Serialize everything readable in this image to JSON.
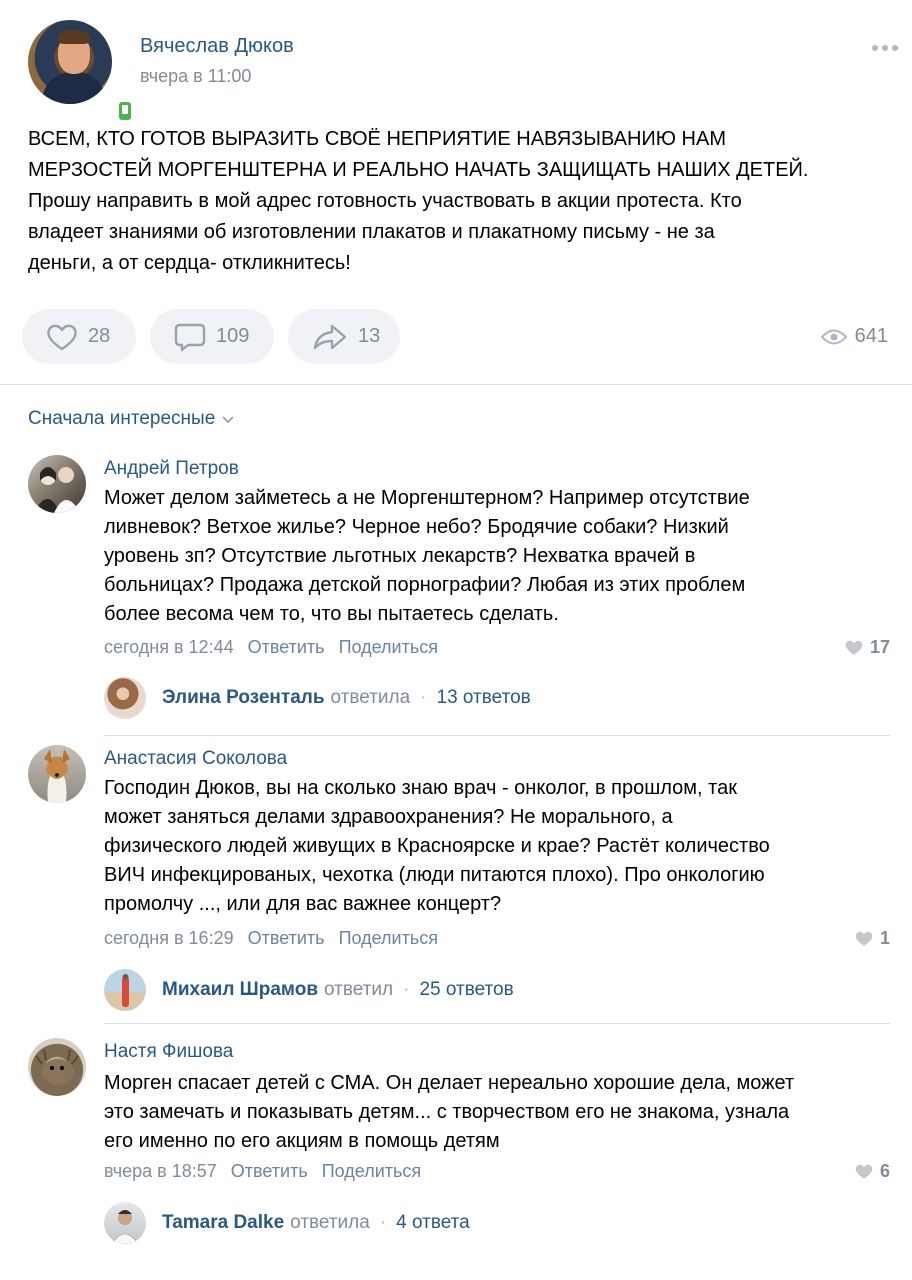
{
  "post": {
    "author": "Вячеслав Дюков",
    "time": "вчера в 11:00",
    "text_lines": [
      "ВСЕМ, КТО ГОТОВ ВЫРАЗИТЬ СВОЁ НЕПРИЯТИЕ НАВЯЗЫВАНИЮ НАМ",
      "МЕРЗОСТЕЙ МОРГЕНШТЕРНА И РЕАЛЬНО НАЧАТЬ ЗАЩИЩАТЬ НАШИХ ДЕТЕЙ.",
      "Прошу направить в мой адрес готовность участвовать в акции протеста. Кто",
      "владеет знаниями об изготовлении плакатов и плакатному письму - не за",
      "деньги, а от сердца- откликнитесь!"
    ],
    "likes": "28",
    "comments": "109",
    "shares": "13",
    "views": "641"
  },
  "sort": {
    "label": "Сначала интересные"
  },
  "comments": [
    {
      "name": "Андрей Петров",
      "text_lines": [
        "Может делом займетесь а не Моргенштерном? Например отсутствие",
        "ливневок? Ветхое жилье? Черное небо? Бродячие собаки? Низкий",
        "уровень зп? Отсутствие льготных лекарств? Нехватка врачей в",
        "больницах? Продажа детской порнографии? Любая из этих проблем",
        "более весома чем то, что вы пытаетесь сделать."
      ],
      "time": "сегодня в 12:44",
      "reply": "Ответить",
      "share": "Поделиться",
      "likes": "17",
      "replier": "Элина Розенталь",
      "replier_verb": "ответила",
      "replies_count": "13 ответов"
    },
    {
      "name": "Анастасия Соколова",
      "text_lines": [
        "Господин Дюков, вы на сколько знаю врач - онколог, в прошлом, так",
        "может заняться делами здравоохранения? Не морального, а",
        "физического людей живущих в Красноярске и крае? Растёт количество",
        "ВИЧ инфекцированых, чехотка (люди питаются плохо). Про онкологию",
        "промолчу ..., или для вас важнее концерт?"
      ],
      "time": "сегодня в 16:29",
      "reply": "Ответить",
      "share": "Поделиться",
      "likes": "1",
      "replier": "Михаил Шрамов",
      "replier_verb": "ответил",
      "replies_count": "25 ответов"
    },
    {
      "name": "Настя Фишова",
      "text_lines": [
        "Морген спасает детей с СМА. Он делает нереально хорошие дела, может",
        "это замечать и показывать детям... с творчеством его не знакома, узнала",
        "его именно по его акциям в помощь детям"
      ],
      "time": "вчера в 18:57",
      "reply": "Ответить",
      "share": "Поделиться",
      "likes": "6",
      "replier": "Tamara Dalke",
      "replier_verb": "ответила",
      "replies_count": "4 ответа"
    }
  ],
  "colors": {
    "link": "#2a5885",
    "muted": "#818c99",
    "button_bg": "#f0f2f5",
    "online": "#4bb34b",
    "divider": "#dce1e6"
  },
  "icons": [
    "more-icon",
    "heart-icon",
    "comment-icon",
    "share-icon",
    "eye-icon",
    "chevron-down-icon",
    "online-mobile-icon"
  ]
}
